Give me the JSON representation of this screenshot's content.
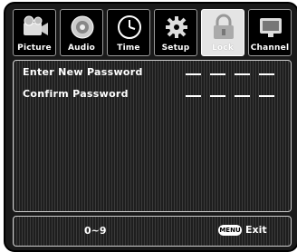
{
  "tabs": [
    {
      "label": "Picture",
      "icon": "camcorder-icon",
      "active": false
    },
    {
      "label": "Audio",
      "icon": "speaker-icon",
      "active": false
    },
    {
      "label": "Time",
      "icon": "clock-icon",
      "active": false
    },
    {
      "label": "Setup",
      "icon": "gear-icon",
      "active": false
    },
    {
      "label": "Lock",
      "icon": "lock-icon",
      "active": true
    },
    {
      "label": "Channel",
      "icon": "tv-icon",
      "active": false
    }
  ],
  "fields": {
    "new_password_label": "Enter New Password",
    "confirm_password_label": "Confirm Password",
    "password_slots": 4
  },
  "footer": {
    "hint": "0~9",
    "menu_key_label": "MENU",
    "exit_label": "Exit"
  },
  "colors": {
    "background": "#1a1a1a",
    "active_tab": "#e4e4e4",
    "text": "#ffffff"
  }
}
